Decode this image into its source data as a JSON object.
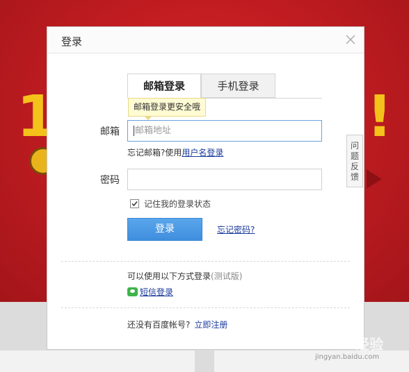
{
  "dialog": {
    "title": "登录",
    "tabs": [
      {
        "label": "邮箱登录",
        "active": true
      },
      {
        "label": "手机登录",
        "active": false
      }
    ],
    "tip": "邮箱登录更安全哦",
    "email": {
      "label": "邮箱",
      "placeholder": "邮箱地址",
      "value": ""
    },
    "forgot_email_text": "忘记邮箱?使用",
    "forgot_email_link": "用户名登录",
    "password": {
      "label": "密码",
      "value": ""
    },
    "remember": {
      "label": "记住我的登录状态",
      "checked": true
    },
    "login_button": "登录",
    "forgot_password": "忘记密码?",
    "other_methods_title": "可以使用以下方式登录",
    "other_methods_note": "(测试版)",
    "sms_login": "短信登录",
    "no_account_text": "还没有百度帐号?",
    "register_link": "立即注册"
  },
  "feedback_tab": "问题反馈",
  "background": {
    "left_glyph": "1",
    "right_glyph": "!"
  },
  "watermark": {
    "main": "Baidu经验",
    "sub": "jingyan.baidu.com"
  },
  "colors": {
    "background_red": "#c21d21",
    "login_button": "#4a98e4",
    "link": "#1a3a9c",
    "tip_bg": "#fffbd3",
    "sms_green": "#3fb44a"
  }
}
